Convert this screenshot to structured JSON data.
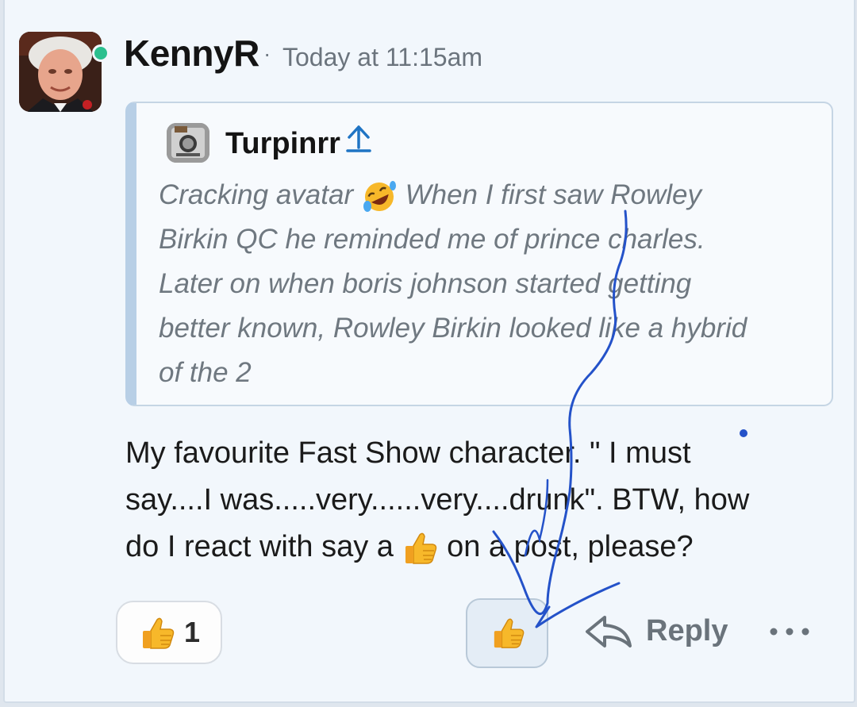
{
  "post": {
    "author": "KennyR",
    "separator": "·",
    "timestamp": "Today at 11:15am",
    "quote": {
      "author": "Turpinrr",
      "lines": [
        "Cracking avatar",
        "When I first saw Rowley",
        "Birkin QC he reminded me of prince charles.",
        "Later on when boris johnson started getting",
        "better known, Rowley Birkin looked like a hybrid",
        "of the 2"
      ]
    },
    "message": {
      "line1": "My favourite Fast Show character. \" I must",
      "line2": "say....I was.....very......very....drunk\". BTW, how",
      "line3_a": "do I react with say a",
      "line3_b": "on a post, please?"
    }
  },
  "reactions": {
    "like_count": "1"
  },
  "actions": {
    "reply_label": "Reply"
  },
  "icons": {
    "like": "thumbs-up-emoji",
    "quote_reaction": "rolling-on-floor-laughing-emoji",
    "reply": "reply-arrow-icon",
    "more": "more-horizontal-icon",
    "go_to_quote": "up-arrow-icon"
  },
  "colors": {
    "accent": "#1f74c4",
    "presence": "#2bbf8e",
    "annotation": "#2452c9"
  }
}
